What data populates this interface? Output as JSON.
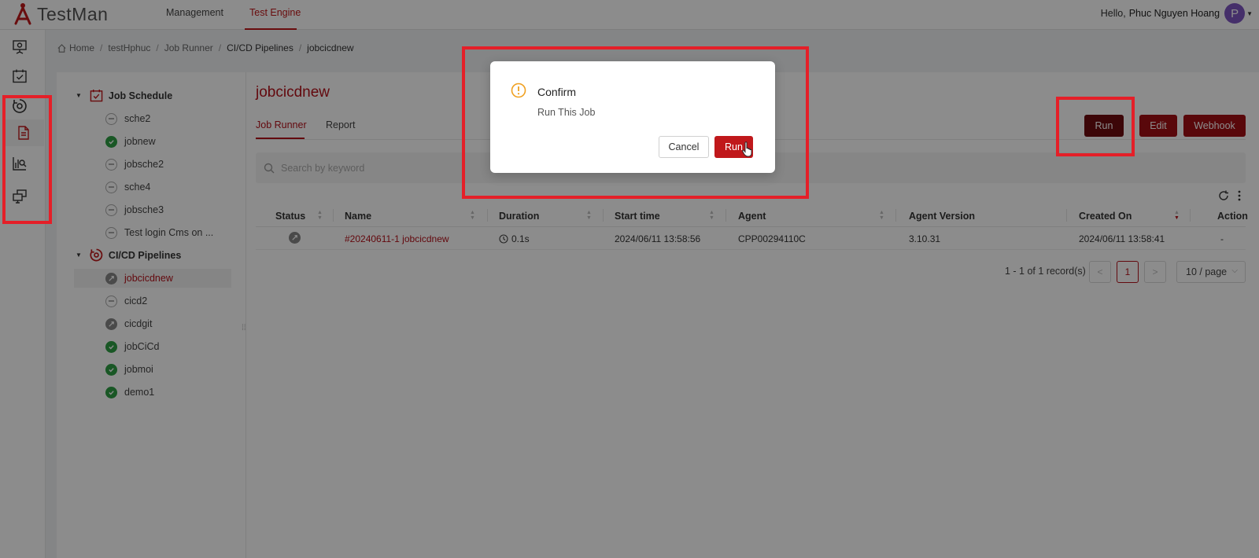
{
  "app": {
    "name": "TestMan"
  },
  "topnav": {
    "items": [
      "Management",
      "Test Engine"
    ],
    "active": "Test Engine"
  },
  "user": {
    "greeting": "Hello,",
    "name": "Phuc Nguyen Hoang",
    "initial": "P"
  },
  "rail": {
    "icons": [
      "presentation-icon",
      "calendar-check-icon",
      "pipeline-icon",
      "document-icon",
      "report-chart-icon",
      "monitors-icon"
    ],
    "selected": "document-icon"
  },
  "breadcrumb": {
    "items": [
      "Home",
      "testHphuc",
      "Job Runner",
      "CI/CD Pipelines",
      "jobcicdnew"
    ]
  },
  "tree": {
    "groups": [
      {
        "label": "Job Schedule",
        "items": [
          {
            "label": "sche2",
            "status": "none"
          },
          {
            "label": "jobnew",
            "status": "success"
          },
          {
            "label": "jobsche2",
            "status": "none"
          },
          {
            "label": "sche4",
            "status": "none"
          },
          {
            "label": "jobsche3",
            "status": "none"
          },
          {
            "label": "Test login Cms on ...",
            "status": "none"
          }
        ]
      },
      {
        "label": "CI/CD Pipelines",
        "items": [
          {
            "label": "jobcicdnew",
            "status": "running",
            "selected": true
          },
          {
            "label": "cicd2",
            "status": "none"
          },
          {
            "label": "cicdgit",
            "status": "running"
          },
          {
            "label": "jobCiCd",
            "status": "success"
          },
          {
            "label": "jobmoi",
            "status": "success"
          },
          {
            "label": "demo1",
            "status": "success"
          }
        ]
      }
    ]
  },
  "main": {
    "title": "jobcicdnew",
    "tabs": [
      "Job Runner",
      "Report"
    ],
    "active_tab": "Job Runner",
    "buttons": {
      "run": "Run",
      "edit": "Edit",
      "webhook": "Webhook"
    },
    "search": {
      "placeholder": "Search by keyword",
      "value": ""
    }
  },
  "table": {
    "columns": [
      "Status",
      "Name",
      "Duration",
      "Start time",
      "Agent",
      "Agent Version",
      "Created On",
      "Action"
    ],
    "sorted_column": "Created On",
    "rows": [
      {
        "status": "running",
        "name": "#20240611-1 jobcicdnew",
        "duration": "0.1s",
        "start_time": "2024/06/11 13:58:56",
        "agent": "CPP00294110C",
        "agent_version": "3.10.31",
        "created_on": "2024/06/11 13:58:41",
        "action": "-"
      }
    ]
  },
  "pagination": {
    "info": "1 - 1 of 1 record(s)",
    "current": "1",
    "page_size": "10 / page",
    "prev": "<",
    "next": ">"
  },
  "modal": {
    "title": "Confirm",
    "message": "Run This Job",
    "cancel": "Cancel",
    "ok": "Run"
  },
  "colors": {
    "brand": "#c0181b",
    "dark_button": "#6e0b10",
    "success": "#2e9e44",
    "warning": "#f0a020",
    "annotation": "#e51f28"
  }
}
